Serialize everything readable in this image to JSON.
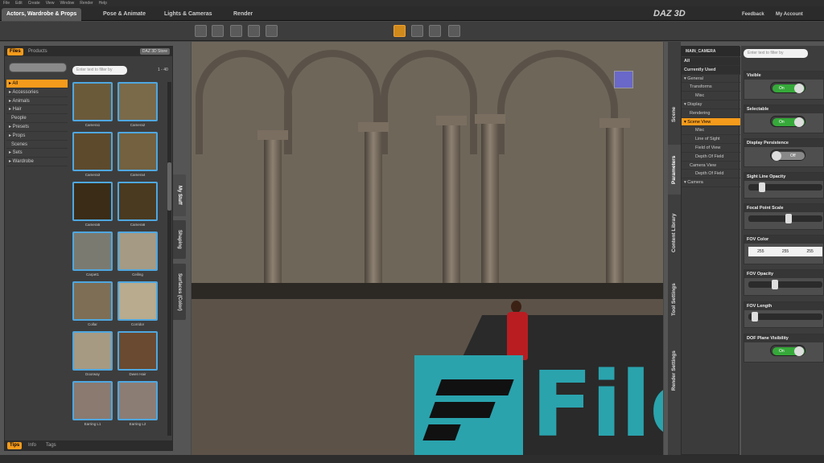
{
  "menubar": [
    "File",
    "Edit",
    "Create",
    "View",
    "Window",
    "Render",
    "Help"
  ],
  "tabs": [
    "Actors, Wardrobe & Props",
    "Pose & Animate",
    "Lights & Cameras",
    "Render"
  ],
  "brand": "DAZ 3D",
  "header_links": {
    "feedback": "Feedback",
    "account": "My Account"
  },
  "left_panel": {
    "tabs": [
      "Files",
      "Products"
    ],
    "daz_button": "DAZ 3D Store",
    "filter_placeholder": "Enter text to filter by",
    "page_count": "1 - 40",
    "categories": [
      {
        "label": "All",
        "level": 0,
        "selected": true
      },
      {
        "label": "Accessories",
        "level": 0
      },
      {
        "label": "Animals",
        "level": 0
      },
      {
        "label": "Hair",
        "level": 0
      },
      {
        "label": "People",
        "level": 1
      },
      {
        "label": "Presets",
        "level": 0
      },
      {
        "label": "Props",
        "level": 0
      },
      {
        "label": "Scenes",
        "level": 1
      },
      {
        "label": "Sets",
        "level": 0
      },
      {
        "label": "Wardrobe",
        "level": 0
      }
    ],
    "thumbnails": [
      {
        "caption": "Camera1"
      },
      {
        "caption": "Camera2"
      },
      {
        "caption": "Camera3"
      },
      {
        "caption": "Camera4"
      },
      {
        "caption": "Camera5"
      },
      {
        "caption": "Camera6"
      },
      {
        "caption": "Carpet1"
      },
      {
        "caption": "Ceiling"
      },
      {
        "caption": "Collar"
      },
      {
        "caption": "Corridor"
      },
      {
        "caption": "Doorway"
      },
      {
        "caption": "Dwen Hair"
      },
      {
        "caption": "Earring L1"
      },
      {
        "caption": "Earring L2"
      }
    ],
    "side_tabs": [
      "My Stuff",
      "Shaping",
      "Surfaces (Color)"
    ],
    "bottom_tabs": [
      "Tips",
      "Info",
      "Tags"
    ]
  },
  "right_panel": {
    "side_tabs": [
      "Scene",
      "Parameters",
      "Content Library",
      "Tool Settings",
      "Render Settings"
    ],
    "camera": "MAIN_CAMERA",
    "tree": [
      {
        "label": "All",
        "cls": "hdr"
      },
      {
        "label": "Currently Used",
        "cls": "hdr"
      },
      {
        "label": "General",
        "cls": "i0"
      },
      {
        "label": "Transforms",
        "cls": "i1"
      },
      {
        "label": "Misc",
        "cls": "i2"
      },
      {
        "label": "Display",
        "cls": "i0"
      },
      {
        "label": "Rendering",
        "cls": "i1"
      },
      {
        "label": "Scene View",
        "cls": "sel"
      },
      {
        "label": "Misc",
        "cls": "i2"
      },
      {
        "label": "Line of Sight",
        "cls": "i2"
      },
      {
        "label": "Field of View",
        "cls": "i2"
      },
      {
        "label": "Depth Of Field",
        "cls": "i2"
      },
      {
        "label": "Camera View",
        "cls": "i1"
      },
      {
        "label": "Depth Of Field",
        "cls": "i2"
      },
      {
        "label": "Camera",
        "cls": "i0"
      }
    ],
    "filter_placeholder": "Enter text to filter by",
    "props": [
      {
        "label": "Visible",
        "type": "toggle",
        "value": "On"
      },
      {
        "label": "Selectable",
        "type": "toggle",
        "value": "On"
      },
      {
        "label": "Display Persistence",
        "type": "toggle",
        "value": "Off"
      },
      {
        "label": "Sight Line Opacity",
        "type": "slider",
        "level": 0.15
      },
      {
        "label": "Focal Point Scale",
        "type": "slider",
        "level": 0.55
      },
      {
        "label": "FOV Color",
        "type": "rgb",
        "rgb": [
          "255",
          "255",
          "255"
        ]
      },
      {
        "label": "FOV Opacity",
        "type": "slider",
        "level": 0.35
      },
      {
        "label": "FOV Length",
        "type": "slider",
        "level": 0.05
      },
      {
        "label": "DOF Plane Visibility",
        "type": "toggle",
        "value": "On"
      }
    ]
  },
  "watermark": "FileCR"
}
